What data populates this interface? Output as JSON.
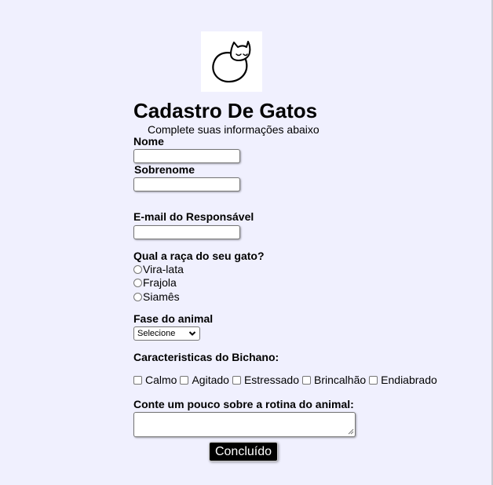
{
  "page": {
    "background": "#f0f0fe",
    "accent": "#000000"
  },
  "logo": {
    "icon": "sleeping-cat-icon"
  },
  "header": {
    "title": "Cadastro De Gatos",
    "subtitle": "Complete suas informações abaixo"
  },
  "form": {
    "nome_label": "Nome",
    "nome_value": "",
    "sobrenome_label": "Sobrenome",
    "sobrenome_value": "",
    "email_label": "E-mail do Responsável",
    "email_value": "",
    "raca_label": "Qual a raça do seu gato?",
    "raca_options": [
      "Vira-lata",
      "Frajola",
      "Siamês"
    ],
    "fase_label": "Fase do animal",
    "fase_selected": "Selecione",
    "caracteristicas_label": "Caracteristicas do Bichano:",
    "caracteristicas_options": [
      "Calmo",
      "Agitado",
      "Estressado",
      "Brincalhão",
      "Endiabrado"
    ],
    "rotina_label": "Conte um pouco sobre a rotina do animal:",
    "rotina_value": "",
    "submit_label": "Concluído"
  }
}
